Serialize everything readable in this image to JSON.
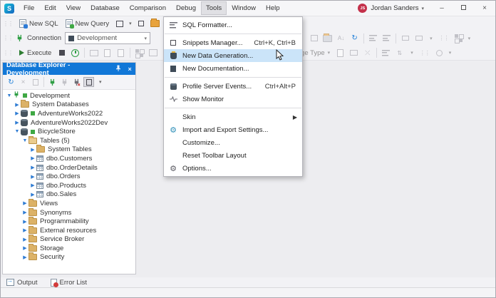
{
  "menubar": {
    "items": [
      "File",
      "Edit",
      "View",
      "Database",
      "Comparison",
      "Debug",
      "Tools",
      "Window",
      "Help"
    ],
    "active_item": "Tools",
    "user_initials": "JS",
    "user_name": "Jordan Sanders"
  },
  "toolbar_standard": {
    "new_sql_label": "New SQL",
    "new_query_label": "New Query"
  },
  "toolbar_connection": {
    "connection_label": "Connection",
    "connection_value": "Development"
  },
  "toolbar_query": {
    "execute_label": "Execute",
    "change_type_label": "Change Type"
  },
  "tools_menu": {
    "items": [
      {
        "label": "SQL Formatter...",
        "shortcut": "",
        "icon": "sql-formatter"
      },
      {
        "label": "Snippets Manager...",
        "shortcut": "Ctrl+K, Ctrl+B",
        "icon": "snippets-manager"
      },
      {
        "label": "New Data Generation...",
        "shortcut": "",
        "icon": "data-generation",
        "highlighted": true
      },
      {
        "label": "New Documentation...",
        "shortcut": "",
        "icon": "documentation"
      },
      {
        "label": "Profile Server Events...",
        "shortcut": "Ctrl+Alt+P",
        "icon": "server-profiler"
      },
      {
        "label": "Show Monitor",
        "shortcut": "",
        "icon": "monitor"
      },
      {
        "label": "Skin",
        "shortcut": "",
        "submenu": true
      },
      {
        "label": "Import and Export Settings...",
        "shortcut": "",
        "icon": "import-export-gear"
      },
      {
        "label": "Customize...",
        "shortcut": ""
      },
      {
        "label": "Reset Toolbar Layout",
        "shortcut": ""
      },
      {
        "label": "Options...",
        "shortcut": "",
        "icon": "options-gear"
      }
    ]
  },
  "explorer": {
    "title": "Database Explorer - Development",
    "tree": [
      {
        "label": "Development",
        "level": 0,
        "state": "expanded",
        "icon": "connection-plug",
        "status_green": true
      },
      {
        "label": "System Databases",
        "level": 1,
        "state": "collapsed",
        "icon": "folder"
      },
      {
        "label": "AdventureWorks2022",
        "level": 1,
        "state": "collapsed",
        "icon": "database",
        "status_green": true
      },
      {
        "label": "AdventureWorks2022Dev",
        "level": 1,
        "state": "collapsed",
        "icon": "database"
      },
      {
        "label": "BicycleStore",
        "level": 1,
        "state": "expanded",
        "icon": "database",
        "status_green": true
      },
      {
        "label": "Tables (5)",
        "level": 2,
        "state": "expanded",
        "icon": "folder-open"
      },
      {
        "label": "System Tables",
        "level": 3,
        "state": "collapsed",
        "icon": "folder"
      },
      {
        "label": "dbo.Customers",
        "level": 3,
        "state": "collapsed",
        "icon": "table"
      },
      {
        "label": "dbo.OrderDetails",
        "level": 3,
        "state": "collapsed",
        "icon": "table"
      },
      {
        "label": "dbo.Orders",
        "level": 3,
        "state": "collapsed",
        "icon": "table"
      },
      {
        "label": "dbo.Products",
        "level": 3,
        "state": "collapsed",
        "icon": "table"
      },
      {
        "label": "dbo.Sales",
        "level": 3,
        "state": "collapsed",
        "icon": "table"
      },
      {
        "label": "Views",
        "level": 2,
        "state": "collapsed",
        "icon": "folder"
      },
      {
        "label": "Synonyms",
        "level": 2,
        "state": "collapsed",
        "icon": "folder"
      },
      {
        "label": "Programmability",
        "level": 2,
        "state": "collapsed",
        "icon": "folder"
      },
      {
        "label": "External resources",
        "level": 2,
        "state": "collapsed",
        "icon": "folder"
      },
      {
        "label": "Service Broker",
        "level": 2,
        "state": "collapsed",
        "icon": "folder"
      },
      {
        "label": "Storage",
        "level": 2,
        "state": "collapsed",
        "icon": "folder"
      },
      {
        "label": "Security",
        "level": 2,
        "state": "collapsed",
        "icon": "folder"
      }
    ]
  },
  "bottom_tabs": {
    "output_label": "Output",
    "error_list_label": "Error List"
  },
  "colors": {
    "panel_header_blue": "#1177D7",
    "menu_highlight_blue": "#CBE4F9",
    "status_green": "#3FA844",
    "avatar_red": "#C4314B",
    "logo_teal": "#17C1D9"
  }
}
